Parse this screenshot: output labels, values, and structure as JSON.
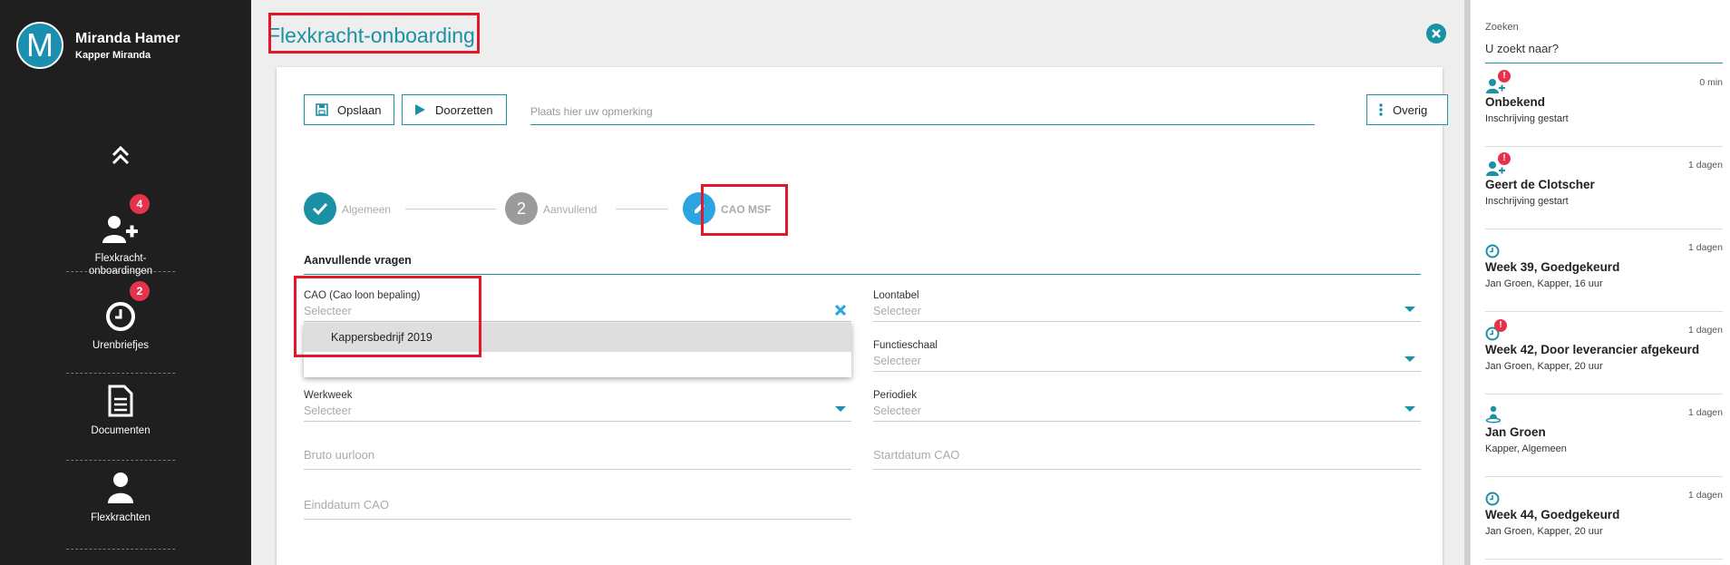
{
  "user": {
    "initial": "M",
    "name": "Miranda Hamer",
    "company": "Kapper Miranda"
  },
  "nav": [
    {
      "label": "Flexkracht-\nonboardingen",
      "badge": "4"
    },
    {
      "label": "Urenbriefjes",
      "badge": "2"
    },
    {
      "label": "Documenten"
    },
    {
      "label": "Flexkrachten"
    }
  ],
  "page": {
    "title": "Flexkracht-onboarding"
  },
  "toolbar": {
    "save_label": "Opslaan",
    "forward_label": "Doorzetten",
    "remark_placeholder": "Plaats hier uw opmerking",
    "more_label": "Overig"
  },
  "steps": [
    {
      "label": "Algemeen",
      "state": "done"
    },
    {
      "number": "2",
      "label": "Aanvullend",
      "state": "todo"
    },
    {
      "label": "CAO MSF",
      "state": "active"
    }
  ],
  "section": {
    "title": "Aanvullende vragen"
  },
  "fields": {
    "cao": {
      "label": "CAO (Cao loon bepaling)",
      "value": "Selecteer"
    },
    "loontabel": {
      "label": "Loontabel",
      "value": "Selecteer"
    },
    "functieschaal": {
      "label": "Functieschaal",
      "value": "Selecteer"
    },
    "werkweek": {
      "label": "Werkweek",
      "value": "Selecteer"
    },
    "periodiek": {
      "label": "Periodiek",
      "value": "Selecteer"
    },
    "bruto_uurloon": {
      "label": "Bruto uurloon"
    },
    "startdatum_cao": {
      "label": "Startdatum CAO"
    },
    "einddatum_cao": {
      "label": "Einddatum CAO"
    }
  },
  "dropdown": {
    "options": [
      "Kappersbedrijf 2019"
    ]
  },
  "search": {
    "label": "Zoeken",
    "value": "U zoekt naar?"
  },
  "feed": [
    {
      "icon": "user-add-alert-icon",
      "time": "0 min",
      "title": "Onbekend",
      "subtitle": "Inschrijving gestart"
    },
    {
      "icon": "user-add-alert-icon",
      "time": "1 dagen",
      "title": "Geert de Clotscher",
      "subtitle": "Inschrijving gestart"
    },
    {
      "icon": "clock-icon",
      "time": "1 dagen",
      "title": "Week 39, Goedgekeurd",
      "subtitle": "Jan Groen, Kapper, 16 uur"
    },
    {
      "icon": "clock-alert-icon",
      "time": "1 dagen",
      "title": "Week 42, Door leverancier afgekeurd",
      "subtitle": "Jan Groen, Kapper, 20 uur"
    },
    {
      "icon": "person-pin-icon",
      "time": "1 dagen",
      "title": "Jan Groen",
      "subtitle": "Kapper, Algemeen"
    },
    {
      "icon": "clock-icon",
      "time": "1 dagen",
      "title": "Week 44, Goedgekeurd",
      "subtitle": "Jan Groen, Kapper, 20 uur"
    }
  ],
  "colors": {
    "accent": "#1b91a6",
    "active_step": "#2aa5df",
    "badge": "#e5334b",
    "highlight": "#e3162b",
    "sidebar": "#1f1f1f"
  }
}
